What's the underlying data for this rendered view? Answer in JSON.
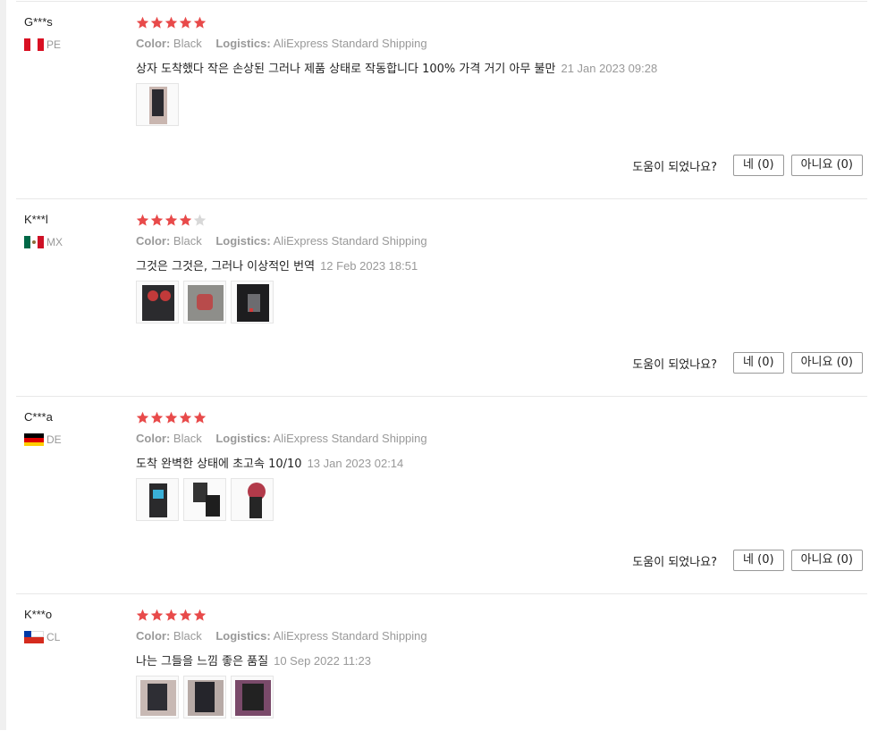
{
  "reviews": [
    {
      "user": "G***s",
      "country": "PE",
      "rating": 5,
      "color_label": "Color:",
      "color_value": "Black",
      "logistics_label": "Logistics:",
      "logistics_value": "AliExpress Standard Shipping",
      "text": "상자 도착했다 작은 손상된 그러나 제품 상태로 작동합니다 100% 가격 거기 아무 불만",
      "date": "21 Jan 2023 09:28",
      "helpful_question": "도움이 되었나요?",
      "yes_label": "네 (0)",
      "no_label": "아니요 (0)"
    },
    {
      "user": "K***l",
      "country": "MX",
      "rating": 4,
      "color_label": "Color:",
      "color_value": "Black",
      "logistics_label": "Logistics:",
      "logistics_value": "AliExpress Standard Shipping",
      "text": "그것은 그것은, 그러나 이상적인 번역",
      "date": "12 Feb 2023 18:51",
      "helpful_question": "도움이 되었나요?",
      "yes_label": "네 (0)",
      "no_label": "아니요 (0)"
    },
    {
      "user": "C***a",
      "country": "DE",
      "rating": 5,
      "color_label": "Color:",
      "color_value": "Black",
      "logistics_label": "Logistics:",
      "logistics_value": "AliExpress Standard Shipping",
      "text": "도착 완벽한 상태에 초고속 10/10",
      "date": "13 Jan 2023 02:14",
      "helpful_question": "도움이 되었나요?",
      "yes_label": "네 (0)",
      "no_label": "아니요 (0)"
    },
    {
      "user": "K***o",
      "country": "CL",
      "rating": 5,
      "color_label": "Color:",
      "color_value": "Black",
      "logistics_label": "Logistics:",
      "logistics_value": "AliExpress Standard Shipping",
      "text": "나는 그들을 느낌 좋은 품질",
      "date": "10 Sep 2022 11:23"
    }
  ],
  "colors": {
    "star_filled": "#e84a4a",
    "star_empty": "#d8d8d8",
    "muted": "#999999"
  }
}
